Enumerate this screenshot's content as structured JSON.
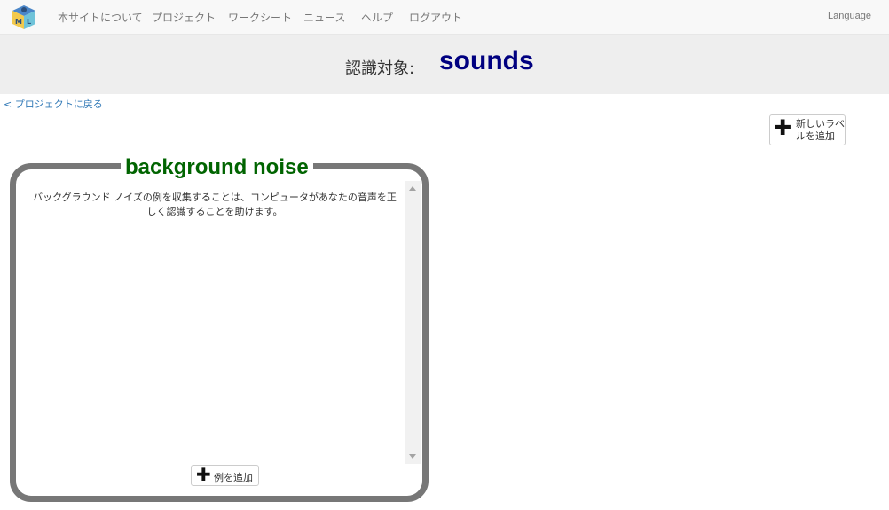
{
  "nav": {
    "items": [
      "本サイトについて",
      "プロジェクト",
      "ワークシート",
      "ニュース",
      "ヘルプ",
      "ログアウト"
    ],
    "language": "Language"
  },
  "banner": {
    "label": "認識対象:",
    "value": "sounds"
  },
  "back_link": "< プロジェクトに戻る",
  "new_label_button": "新しいラベルを追加",
  "label_card": {
    "title": "background noise",
    "description": "バックグラウンド ノイズの例を収集することは、コンピュータがあなたの音声を正しく認識することを助けます。",
    "add_example_button": "例を追加"
  },
  "colors": {
    "title_green": "#006400",
    "value_navy": "#000080",
    "card_border": "#777777",
    "link_blue": "#337ab7"
  }
}
